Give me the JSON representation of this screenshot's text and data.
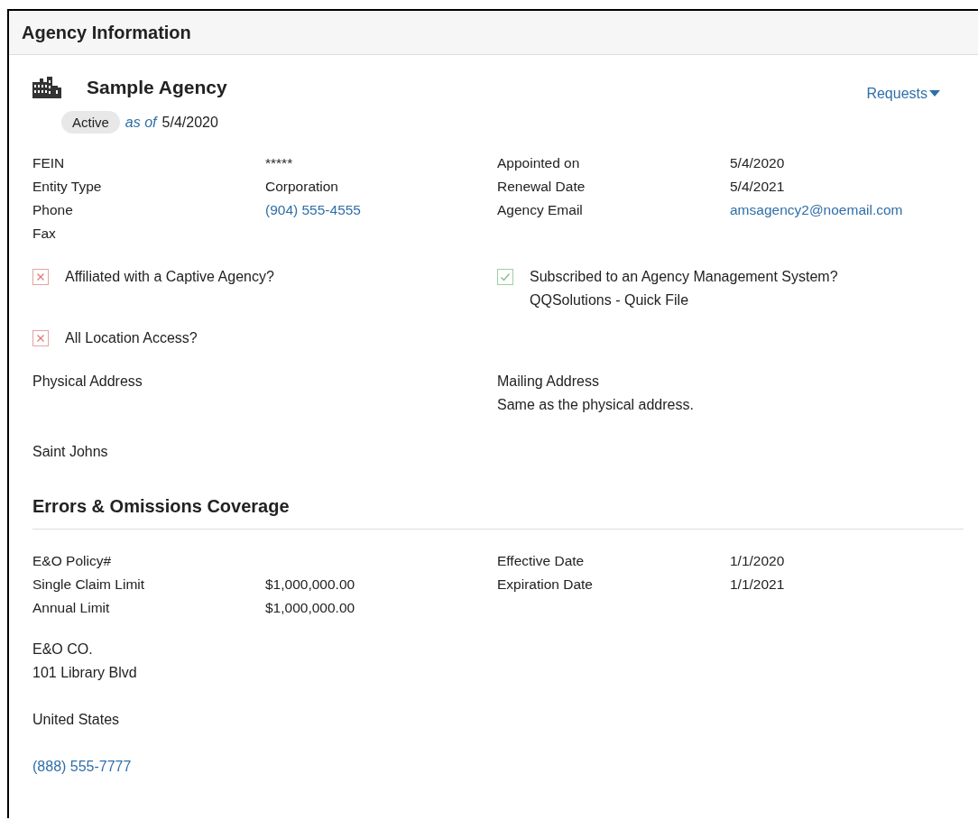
{
  "panel": {
    "title": "Agency Information"
  },
  "agency": {
    "name": "Sample Agency",
    "status": "Active",
    "as_of_label": "as of",
    "as_of_date": "5/4/2020",
    "requests_menu": "Requests"
  },
  "details_left": [
    {
      "label": "FEIN",
      "value": "*****",
      "kind": "text"
    },
    {
      "label": "Entity Type",
      "value": "Corporation",
      "kind": "text"
    },
    {
      "label": "Phone",
      "value": "(904) 555-4555",
      "kind": "link"
    },
    {
      "label": "Fax"
    }
  ],
  "details_right": [
    {
      "label": "Appointed on",
      "value": "5/4/2020",
      "kind": "text"
    },
    {
      "label": "Renewal Date",
      "value": "5/4/2021",
      "kind": "text"
    },
    {
      "label": "Agency Email",
      "value": "amsagency2@noemail.com",
      "kind": "link"
    }
  ],
  "flags": [
    {
      "label": "Affiliated with a Captive Agency?",
      "checked": false
    },
    {
      "label": "Subscribed to an Agency Management System?",
      "checked": true,
      "detail": "QQSolutions - Quick File"
    },
    {
      "label": "All Location Access?",
      "checked": false
    }
  ],
  "physical_address": {
    "label": "Physical Address",
    "county": "Saint Johns"
  },
  "mailing_address": {
    "label": "Mailing Address",
    "note": "Same as the physical address."
  },
  "eo_coverage": {
    "title": "Errors & Omissions Coverage",
    "details_left": [
      {
        "label": "E&O Policy#"
      },
      {
        "label": "Single Claim Limit",
        "value": "$1,000,000.00",
        "kind": "text"
      },
      {
        "label": "Annual Limit",
        "value": "$1,000,000.00",
        "kind": "text"
      }
    ],
    "details_right": [
      {
        "label": "Effective Date",
        "value": "1/1/2020",
        "kind": "text"
      },
      {
        "label": "Expiration Date",
        "value": "1/1/2021",
        "kind": "text"
      }
    ],
    "company_lines": [
      "E&O CO.",
      "101 Library Blvd"
    ],
    "country": "United States",
    "phone": "(888) 555-7777"
  }
}
